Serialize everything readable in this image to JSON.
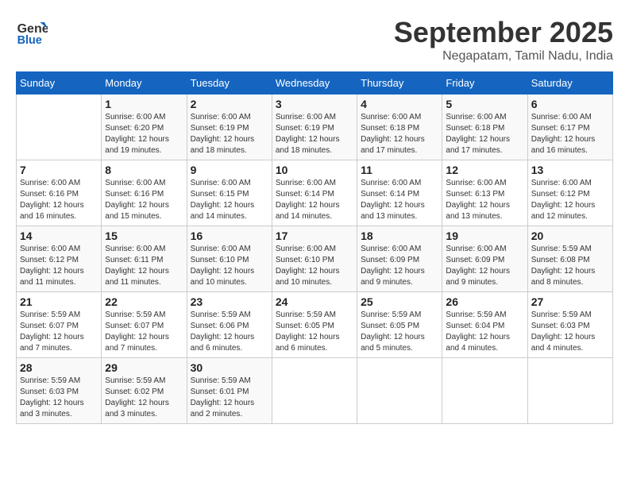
{
  "header": {
    "logo_line1": "General",
    "logo_line2": "Blue",
    "month": "September 2025",
    "location": "Negapatam, Tamil Nadu, India"
  },
  "days_of_week": [
    "Sunday",
    "Monday",
    "Tuesday",
    "Wednesday",
    "Thursday",
    "Friday",
    "Saturday"
  ],
  "weeks": [
    [
      {
        "day": "",
        "info": ""
      },
      {
        "day": "1",
        "info": "Sunrise: 6:00 AM\nSunset: 6:20 PM\nDaylight: 12 hours\nand 19 minutes."
      },
      {
        "day": "2",
        "info": "Sunrise: 6:00 AM\nSunset: 6:19 PM\nDaylight: 12 hours\nand 18 minutes."
      },
      {
        "day": "3",
        "info": "Sunrise: 6:00 AM\nSunset: 6:19 PM\nDaylight: 12 hours\nand 18 minutes."
      },
      {
        "day": "4",
        "info": "Sunrise: 6:00 AM\nSunset: 6:18 PM\nDaylight: 12 hours\nand 17 minutes."
      },
      {
        "day": "5",
        "info": "Sunrise: 6:00 AM\nSunset: 6:18 PM\nDaylight: 12 hours\nand 17 minutes."
      },
      {
        "day": "6",
        "info": "Sunrise: 6:00 AM\nSunset: 6:17 PM\nDaylight: 12 hours\nand 16 minutes."
      }
    ],
    [
      {
        "day": "7",
        "info": "Sunrise: 6:00 AM\nSunset: 6:16 PM\nDaylight: 12 hours\nand 16 minutes."
      },
      {
        "day": "8",
        "info": "Sunrise: 6:00 AM\nSunset: 6:16 PM\nDaylight: 12 hours\nand 15 minutes."
      },
      {
        "day": "9",
        "info": "Sunrise: 6:00 AM\nSunset: 6:15 PM\nDaylight: 12 hours\nand 14 minutes."
      },
      {
        "day": "10",
        "info": "Sunrise: 6:00 AM\nSunset: 6:14 PM\nDaylight: 12 hours\nand 14 minutes."
      },
      {
        "day": "11",
        "info": "Sunrise: 6:00 AM\nSunset: 6:14 PM\nDaylight: 12 hours\nand 13 minutes."
      },
      {
        "day": "12",
        "info": "Sunrise: 6:00 AM\nSunset: 6:13 PM\nDaylight: 12 hours\nand 13 minutes."
      },
      {
        "day": "13",
        "info": "Sunrise: 6:00 AM\nSunset: 6:12 PM\nDaylight: 12 hours\nand 12 minutes."
      }
    ],
    [
      {
        "day": "14",
        "info": "Sunrise: 6:00 AM\nSunset: 6:12 PM\nDaylight: 12 hours\nand 11 minutes."
      },
      {
        "day": "15",
        "info": "Sunrise: 6:00 AM\nSunset: 6:11 PM\nDaylight: 12 hours\nand 11 minutes."
      },
      {
        "day": "16",
        "info": "Sunrise: 6:00 AM\nSunset: 6:10 PM\nDaylight: 12 hours\nand 10 minutes."
      },
      {
        "day": "17",
        "info": "Sunrise: 6:00 AM\nSunset: 6:10 PM\nDaylight: 12 hours\nand 10 minutes."
      },
      {
        "day": "18",
        "info": "Sunrise: 6:00 AM\nSunset: 6:09 PM\nDaylight: 12 hours\nand 9 minutes."
      },
      {
        "day": "19",
        "info": "Sunrise: 6:00 AM\nSunset: 6:09 PM\nDaylight: 12 hours\nand 9 minutes."
      },
      {
        "day": "20",
        "info": "Sunrise: 5:59 AM\nSunset: 6:08 PM\nDaylight: 12 hours\nand 8 minutes."
      }
    ],
    [
      {
        "day": "21",
        "info": "Sunrise: 5:59 AM\nSunset: 6:07 PM\nDaylight: 12 hours\nand 7 minutes."
      },
      {
        "day": "22",
        "info": "Sunrise: 5:59 AM\nSunset: 6:07 PM\nDaylight: 12 hours\nand 7 minutes."
      },
      {
        "day": "23",
        "info": "Sunrise: 5:59 AM\nSunset: 6:06 PM\nDaylight: 12 hours\nand 6 minutes."
      },
      {
        "day": "24",
        "info": "Sunrise: 5:59 AM\nSunset: 6:05 PM\nDaylight: 12 hours\nand 6 minutes."
      },
      {
        "day": "25",
        "info": "Sunrise: 5:59 AM\nSunset: 6:05 PM\nDaylight: 12 hours\nand 5 minutes."
      },
      {
        "day": "26",
        "info": "Sunrise: 5:59 AM\nSunset: 6:04 PM\nDaylight: 12 hours\nand 4 minutes."
      },
      {
        "day": "27",
        "info": "Sunrise: 5:59 AM\nSunset: 6:03 PM\nDaylight: 12 hours\nand 4 minutes."
      }
    ],
    [
      {
        "day": "28",
        "info": "Sunrise: 5:59 AM\nSunset: 6:03 PM\nDaylight: 12 hours\nand 3 minutes."
      },
      {
        "day": "29",
        "info": "Sunrise: 5:59 AM\nSunset: 6:02 PM\nDaylight: 12 hours\nand 3 minutes."
      },
      {
        "day": "30",
        "info": "Sunrise: 5:59 AM\nSunset: 6:01 PM\nDaylight: 12 hours\nand 2 minutes."
      },
      {
        "day": "",
        "info": ""
      },
      {
        "day": "",
        "info": ""
      },
      {
        "day": "",
        "info": ""
      },
      {
        "day": "",
        "info": ""
      }
    ]
  ]
}
